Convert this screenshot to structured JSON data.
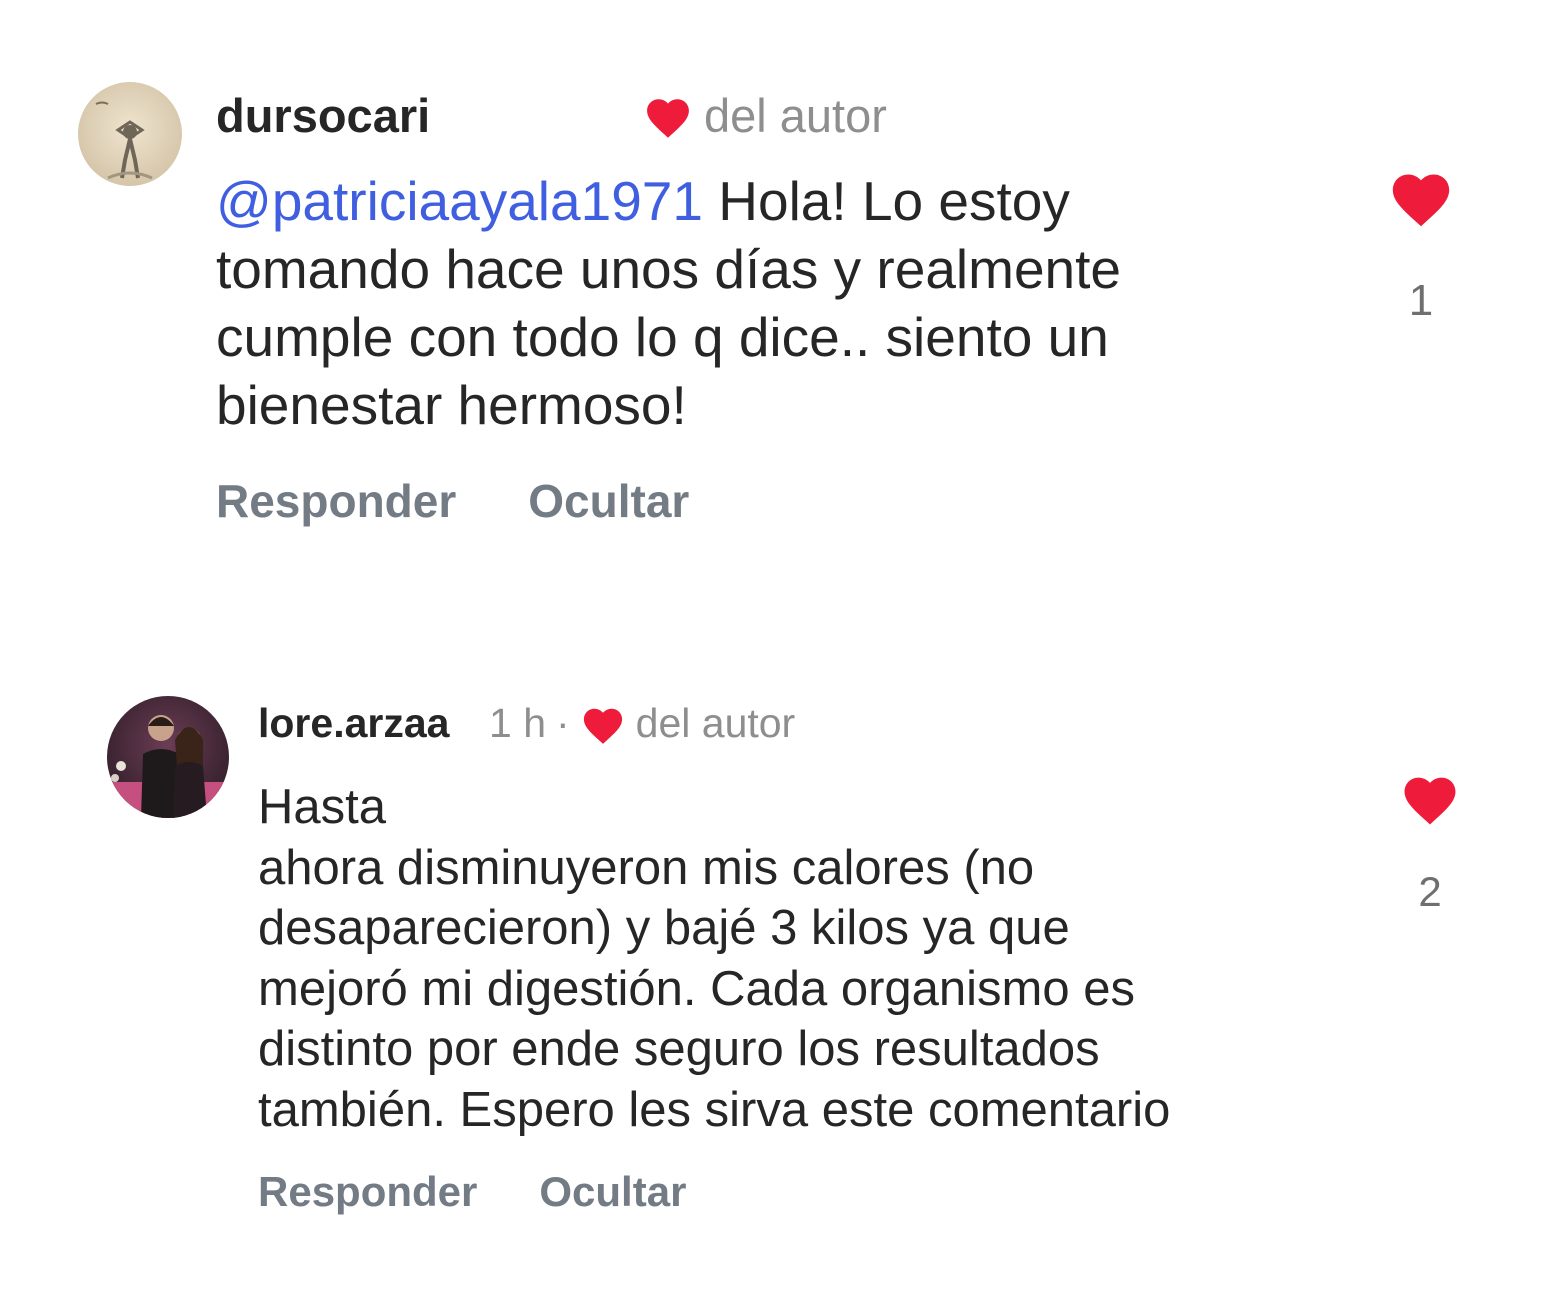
{
  "comments": [
    {
      "username": "dursocari",
      "author_like_label": "del autor",
      "mention": "@patriciaayala1971",
      "text_lines": [
        " Hola! Lo estoy",
        "tomando hace unos días y realmente",
        "cumple con todo lo q dice.. siento un",
        "bienestar hermoso!"
      ],
      "reply_label": "Responder",
      "hide_label": "Ocultar",
      "like_count": "1",
      "like_icon": "heart-icon",
      "author_like_icon": "heart-icon"
    },
    {
      "username": "lore.arzaa",
      "timestamp": "1 h",
      "separator": "·",
      "author_like_label": "del autor",
      "text_lines": [
        "Hasta",
        "ahora disminuyeron mis calores (no",
        "desaparecieron) y bajé 3 kilos ya que",
        "mejoró mi digestión. Cada organismo es",
        "distinto por ende seguro los resultados",
        "también. Espero les sirva este comentario"
      ],
      "reply_label": "Responder",
      "hide_label": "Ocultar",
      "like_count": "2",
      "like_icon": "heart-icon",
      "author_like_icon": "heart-icon"
    }
  ],
  "colors": {
    "heart": "#ee1c3a",
    "mention": "#3f5ee0",
    "text": "#262626",
    "muted": "#8e8e8e",
    "action": "#737b84"
  }
}
